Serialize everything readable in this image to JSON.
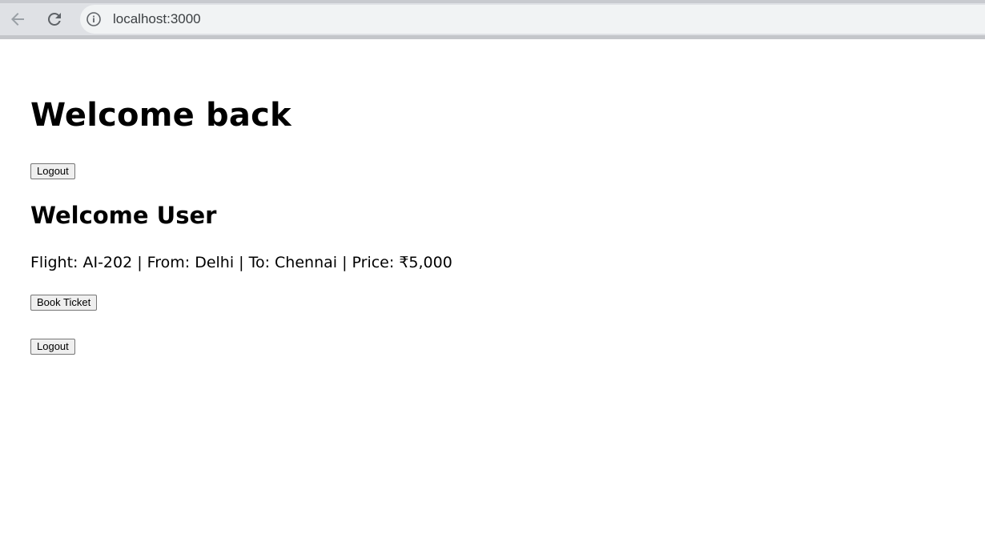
{
  "browser": {
    "url": "localhost:3000",
    "icons": [
      "back-arrow-icon",
      "reload-icon",
      "info-icon"
    ]
  },
  "page": {
    "heading": "Welcome back",
    "logout_top_label": "Logout",
    "subheading": "Welcome User",
    "flight_line": "Flight: AI-202 | From: Delhi | To: Chennai | Price: ₹5,000",
    "book_label": "Book Ticket",
    "logout_bottom_label": "Logout"
  }
}
